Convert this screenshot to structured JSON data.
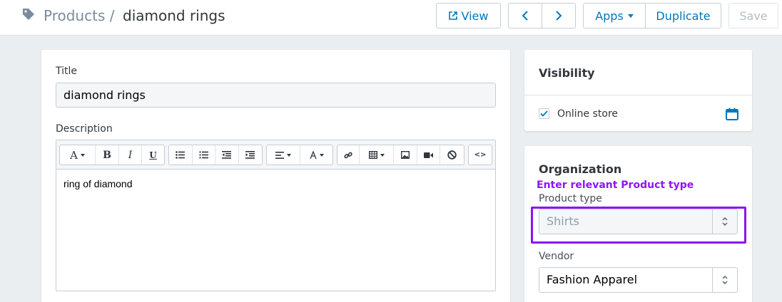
{
  "breadcrumb": {
    "parent": "Products /",
    "current": "diamond rings"
  },
  "toolbar": {
    "view_label": "View",
    "apps_label": "Apps",
    "duplicate_label": "Duplicate",
    "save_label": "Save"
  },
  "form": {
    "title_label": "Title",
    "title_value": "diamond rings",
    "description_label": "Description",
    "description_value": "ring of diamond"
  },
  "editor_toolbar": {
    "font_glyph": "A",
    "bold_glyph": "B",
    "italic_glyph": "I",
    "underline_glyph": "U",
    "code_glyph": "<>"
  },
  "visibility": {
    "title": "Visibility",
    "online_store_label": "Online store",
    "online_store_checked": true
  },
  "organization": {
    "title": "Organization",
    "hint": "Enter relevant Product type",
    "product_type_label": "Product type",
    "product_type_placeholder": "Shirts",
    "vendor_label": "Vendor",
    "vendor_value": "Fashion Apparel"
  },
  "colors": {
    "accent": "#0078bd",
    "highlight": "#8d12f5",
    "hint": "#9013fe"
  }
}
